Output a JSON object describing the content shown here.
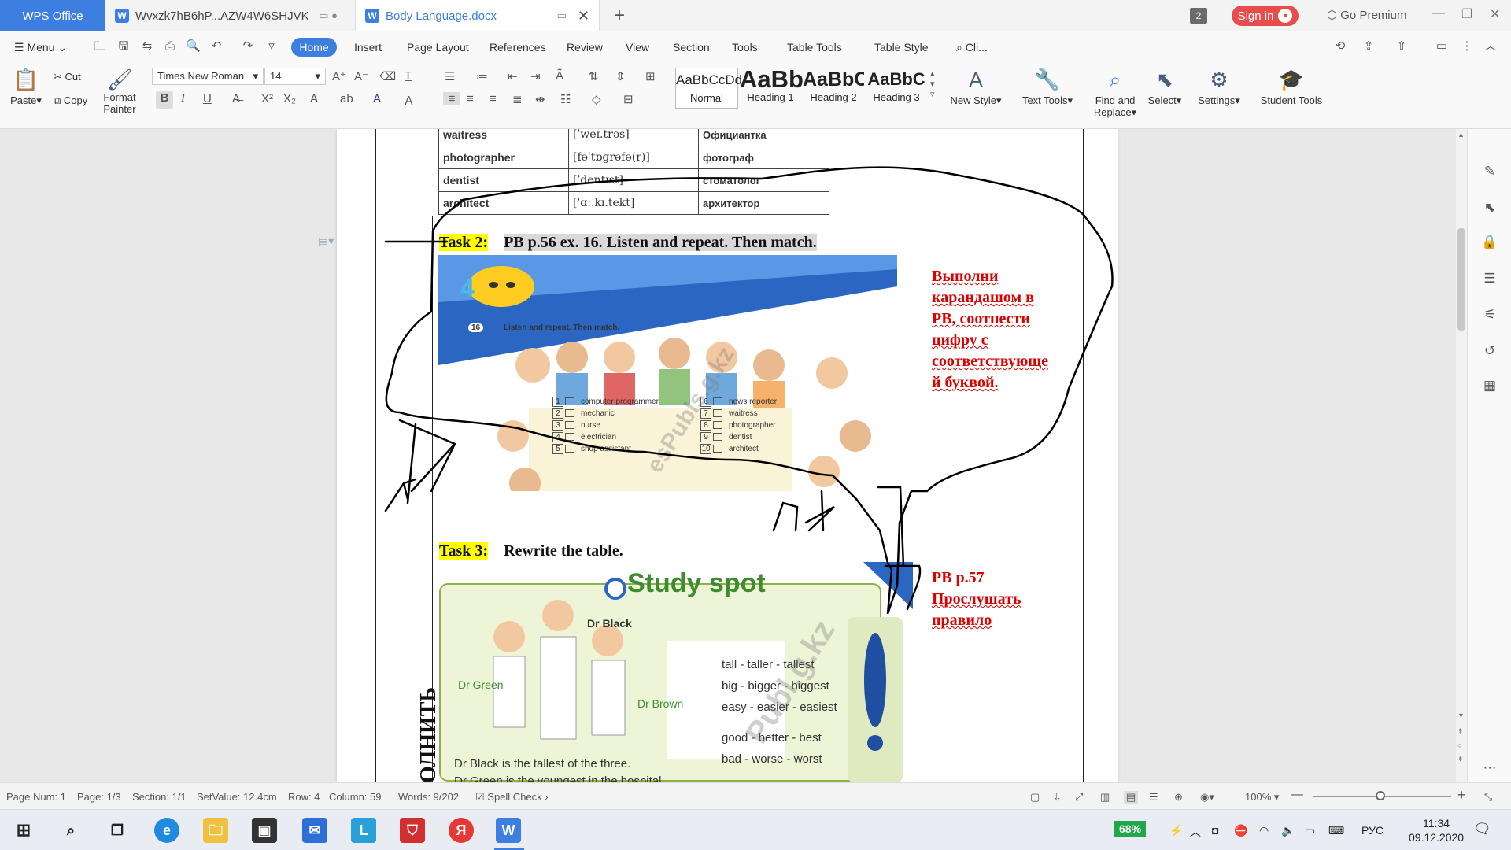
{
  "titlebar": {
    "app_tab": "WPS Office",
    "doc_tab_1": "Wvxzk7hB6hP...AZW4W6SHJVK",
    "doc_tab_2": "Body Language.docx",
    "doc_count": "2",
    "signin": "Sign in",
    "premium": "Go Premium"
  },
  "menubar": {
    "menu": "Menu",
    "items": [
      "Home",
      "Insert",
      "Page Layout",
      "References",
      "Review",
      "View",
      "Section",
      "Tools",
      "Table Tools",
      "Table Style"
    ],
    "search": "Cli..."
  },
  "ribbon": {
    "paste": "Paste",
    "cut": "Cut",
    "copy": "Copy",
    "format_painter_1": "Format",
    "format_painter_2": "Painter",
    "font_name": "Times New Roman",
    "font_size": "14",
    "styles": [
      {
        "sample": "AaBbCcDd",
        "name": "Normal"
      },
      {
        "sample": "AaBb",
        "name": "Heading 1"
      },
      {
        "sample": "AaBbC",
        "name": "Heading 2"
      },
      {
        "sample": "AaBbC",
        "name": "Heading 3"
      }
    ],
    "new_style": "New Style",
    "text_tools": "Text Tools",
    "find_replace_1": "Find and",
    "find_replace_2": "Replace",
    "select": "Select",
    "settings": "Settings",
    "student_tools": "Student Tools"
  },
  "document": {
    "table_rows": [
      {
        "en": "waitress",
        "ipa": "[ˈweɪ.trəs]",
        "ru": "Официантка"
      },
      {
        "en": "photographer",
        "ipa": "[fəˈtɒɡrəfə(r)]",
        "ru": "фотограф"
      },
      {
        "en": "dentist",
        "ipa": "[ˈdentɪst]",
        "ru": "стоматолог"
      },
      {
        "en": "architect",
        "ipa": "[ˈɑː.kɪ.tekt]",
        "ru": "архитектор"
      }
    ],
    "task2_label": "Task 2:",
    "task2_text": "PB p.56 ex. 16. Listen and repeat. Then match.",
    "task2_note": [
      "Выполни",
      "карандашом в",
      "РВ, соотнести",
      "цифру с",
      "соответствующе",
      "й буквой."
    ],
    "task3_label": "Task 3:",
    "task3_text": "Rewrite the table.",
    "task3_note": [
      "РВ р.57",
      "Прослушать",
      "правило"
    ],
    "vertical_text": "ОЛНИТЬ",
    "image1": {
      "badge": "4",
      "exercise": "16",
      "instruction": "Listen and repeat. Then match.",
      "left_list": [
        "computer programmer",
        "mechanic",
        "nurse",
        "electrician",
        "shop assistant"
      ],
      "left_nums": [
        "1",
        "2",
        "3",
        "4",
        "5"
      ],
      "right_list": [
        "news reporter",
        "waitress",
        "photographer",
        "dentist",
        "architect"
      ],
      "right_nums": [
        "6",
        "7",
        "8",
        "9",
        "10"
      ],
      "watermark": "esPubls.g.kz"
    },
    "image2": {
      "title": "Study spot",
      "names": [
        "Dr Black",
        "Dr Green",
        "Dr Brown"
      ],
      "rules": [
        "tall - taller - tallest",
        "big - bigger - biggest",
        "easy - easier - easiest",
        "good - better - best",
        "bad - worse - worst"
      ],
      "sentences": [
        "Dr Black is the tallest of the three.",
        "Dr Green is the youngest in the hospital."
      ],
      "watermark": "Publ.g.kz"
    }
  },
  "statusbar": {
    "page_num": "Page Num: 1",
    "page": "Page: 1/3",
    "section": "Section: 1/1",
    "setvalue": "SetValue: 12.4cm",
    "row": "Row: 4",
    "column": "Column: 59",
    "words": "Words: 9/202",
    "spell": "Spell Check",
    "zoom": "100%"
  },
  "taskbar": {
    "battery": "68%",
    "lang": "РУС",
    "time": "11:34",
    "date": "09.12.2020"
  },
  "colors": {
    "accent": "#3c7fe0",
    "signin": "#e84c4c",
    "note_red": "#dd0000",
    "highlight_yellow": "#ffff00"
  }
}
